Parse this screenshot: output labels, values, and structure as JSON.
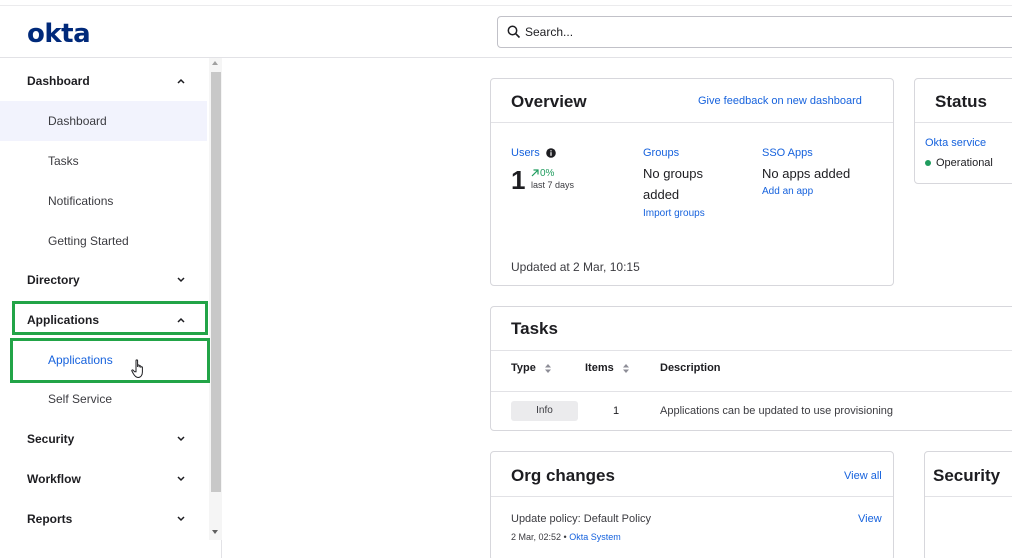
{
  "app": {
    "logo": "okta"
  },
  "search": {
    "placeholder": "Search..."
  },
  "sidebar": {
    "sections": [
      {
        "label": "Dashboard",
        "expanded": true,
        "items": [
          "Dashboard",
          "Tasks",
          "Notifications",
          "Getting Started"
        ]
      },
      {
        "label": "Directory",
        "expanded": false
      },
      {
        "label": "Applications",
        "expanded": true,
        "items": [
          "Applications",
          "Self Service"
        ]
      },
      {
        "label": "Security",
        "expanded": false
      },
      {
        "label": "Workflow",
        "expanded": false
      },
      {
        "label": "Reports",
        "expanded": false
      }
    ],
    "active_item": "Dashboard",
    "highlight_item": "Applications"
  },
  "overview": {
    "title": "Overview",
    "feedback_link": "Give feedback on new dashboard",
    "users": {
      "label": "Users",
      "value": "1",
      "change": "0%",
      "period": "last 7 days"
    },
    "groups": {
      "label": "Groups",
      "text_line1": "No groups",
      "text_line2": "added",
      "link": "Import groups"
    },
    "sso": {
      "label": "SSO Apps",
      "text": "No apps added",
      "link": "Add an app"
    },
    "updated": "Updated at 2 Mar, 10:15"
  },
  "status": {
    "title": "Status",
    "service": "Okta service",
    "state": "Operational",
    "state_color": "#1f9c5e"
  },
  "tasks": {
    "title": "Tasks",
    "columns": [
      "Type",
      "Items",
      "Description"
    ],
    "rows": [
      {
        "type": "Info",
        "items": "1",
        "description": "Applications can be updated to use provisioning"
      }
    ]
  },
  "org_changes": {
    "title": "Org changes",
    "view_all": "View all",
    "entries": [
      {
        "title": "Update policy: Default Policy",
        "time": "2 Mar, 02:52",
        "actor": "Okta System",
        "action": "View"
      }
    ]
  },
  "security_card": {
    "title": "Security"
  },
  "colors": {
    "brand": "#00297a",
    "link": "#1662dd",
    "highlight_box": "#22a447",
    "active_bg": "#f2f3fd"
  }
}
